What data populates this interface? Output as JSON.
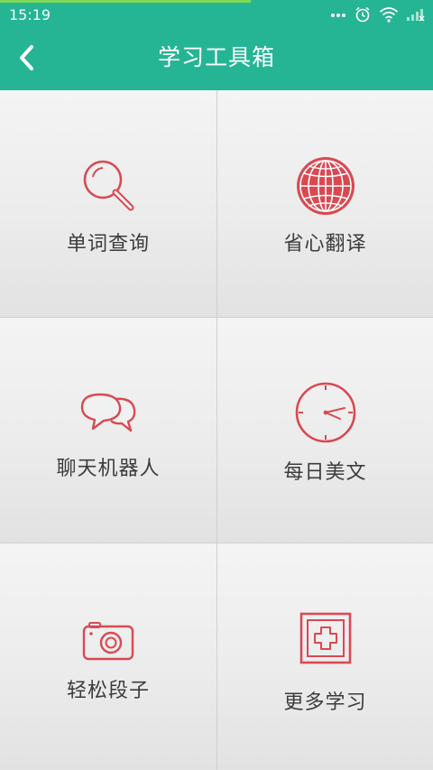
{
  "status_bar": {
    "time": "15:19",
    "icons": [
      "more-dots-icon",
      "alarm-icon",
      "wifi-icon",
      "signal-icon"
    ]
  },
  "nav": {
    "back_icon": "chevron-left-icon",
    "title": "学习工具箱"
  },
  "colors": {
    "primary": "#26b594",
    "icon_red": "#d84a52",
    "label": "#3c3c3c"
  },
  "tools": [
    {
      "label": "单词查询",
      "icon": "search-icon"
    },
    {
      "label": "省心翻译",
      "icon": "globe-icon"
    },
    {
      "label": "聊天机器人",
      "icon": "chat-bubbles-icon"
    },
    {
      "label": "每日美文",
      "icon": "clock-icon"
    },
    {
      "label": "轻松段子",
      "icon": "camera-icon"
    },
    {
      "label": "更多学习",
      "icon": "plus-box-icon"
    }
  ]
}
